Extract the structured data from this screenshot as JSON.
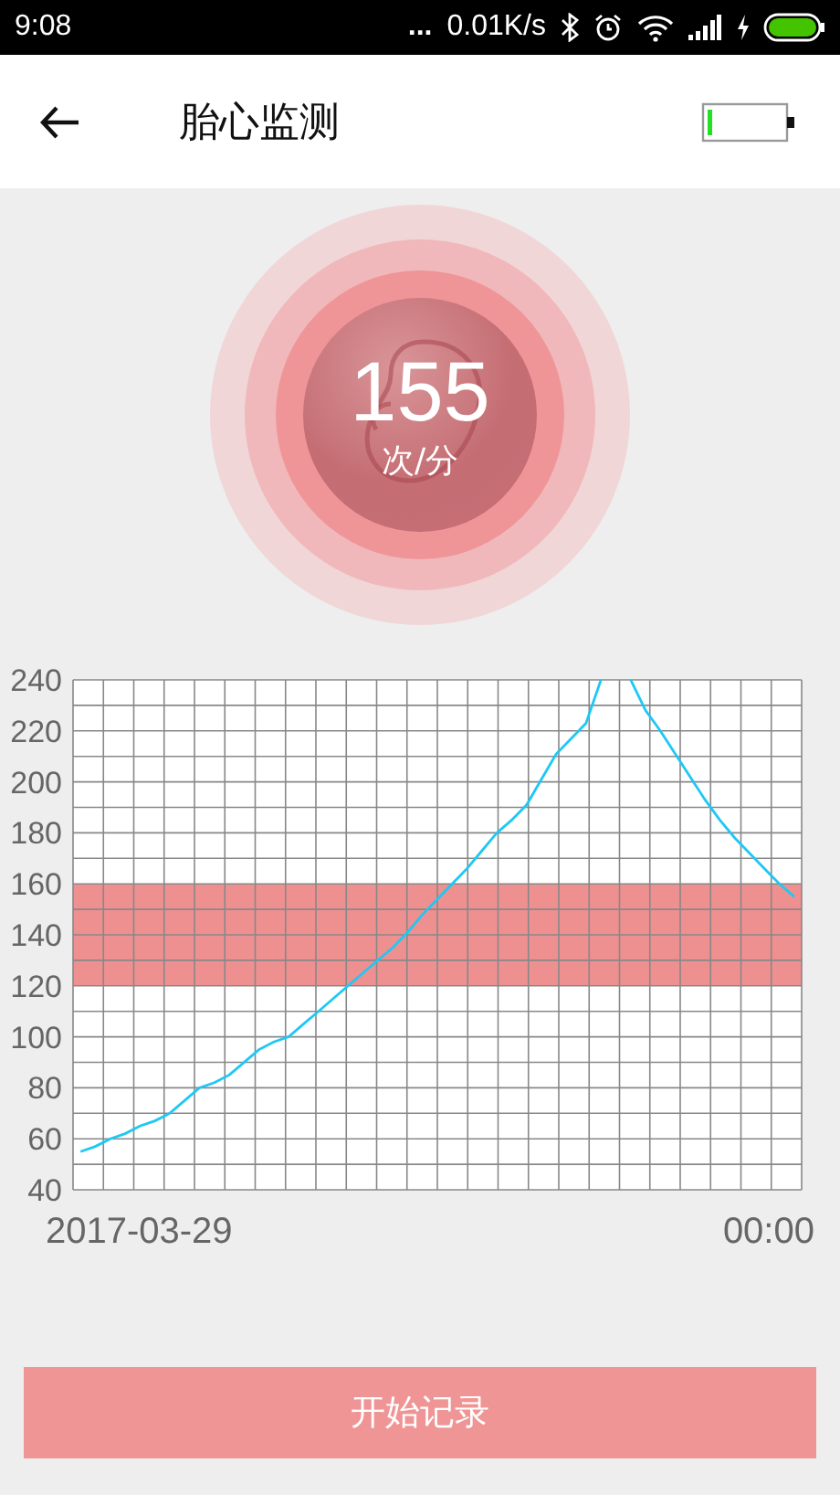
{
  "status_bar": {
    "time": "9:08",
    "more": "...",
    "speed": "0.01K/s"
  },
  "header": {
    "title": "胎心监测"
  },
  "heart_rate": {
    "value": "155",
    "unit": "次/分"
  },
  "chart": {
    "chart_data": {
      "type": "line",
      "ylim": [
        40,
        240
      ],
      "grid": true,
      "yticks": [
        40,
        60,
        80,
        100,
        120,
        140,
        160,
        180,
        200,
        220,
        240
      ],
      "categories": [
        null,
        null,
        null,
        null,
        null,
        null,
        null,
        null,
        null,
        null,
        null,
        null,
        null,
        null,
        null,
        null,
        null,
        null,
        null,
        null,
        null,
        null,
        null,
        null,
        null,
        null,
        null,
        null,
        null,
        null,
        null,
        null,
        null,
        null,
        null,
        null,
        null,
        null,
        null,
        null,
        null,
        null,
        null,
        null,
        null,
        null,
        null,
        null,
        null
      ],
      "series": [
        {
          "color": "#1ec8f5",
          "values": [
            55,
            57,
            60,
            62,
            65,
            67,
            70,
            75,
            80,
            82,
            85,
            90,
            95,
            98,
            100,
            105,
            110,
            115,
            120,
            125,
            130,
            135,
            141,
            148,
            154,
            160,
            166,
            173,
            180,
            185,
            191,
            201,
            211,
            217,
            223,
            240,
            null,
            240,
            228,
            220,
            211,
            202,
            193,
            185,
            178,
            172,
            166,
            160,
            155
          ]
        }
      ],
      "bands": [
        {
          "axis": "y",
          "from": 120,
          "to": 160,
          "color": "#ee9090"
        }
      ]
    },
    "start_label": "2017-03-29",
    "end_label": "00:00"
  },
  "button": {
    "label": "开始记录"
  }
}
